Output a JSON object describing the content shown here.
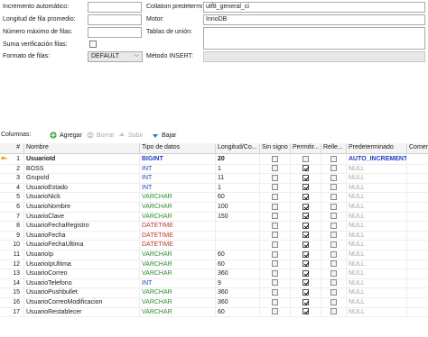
{
  "options": {
    "auto_increment_label": "Incremento automático:",
    "avg_row_length_label": "Longitud de fila promedio:",
    "max_rows_label": "Número máximo de filas:",
    "checksum_label": "Suma verificación filas:",
    "row_format_label": "Formato de filas:",
    "row_format_value": "DEFAULT",
    "collation_label": "Collation predetermi",
    "collation_value": "utf8_general_ci",
    "engine_label": "Motor:",
    "engine_value": "InnoDB",
    "union_tables_label": "Tablas de unión:",
    "insert_method_label": "Método INSERT:"
  },
  "toolbar": {
    "columns_label": "Columnas:",
    "add_label": "Agregar",
    "remove_label": "Borrar",
    "up_label": "Subir",
    "down_label": "Bajar"
  },
  "grid": {
    "headers": [
      "#",
      "Nombre",
      "Tipo de datos",
      "Longitud/Co...",
      "Sin signo",
      "Permitir...",
      "Relle...",
      "Predeterminado",
      "Comen"
    ],
    "rows": [
      {
        "num": "1",
        "name": "UsuarioId",
        "type": "BIGINT",
        "length": "20",
        "unsigned": false,
        "nullable": false,
        "zerofill": false,
        "default": "AUTO_INCREMENT",
        "type_color": "#1f3fbf",
        "default_color": "#1f3fbf",
        "selected": true,
        "key": true
      },
      {
        "num": "2",
        "name": "BOSS",
        "type": "INT",
        "length": "1",
        "unsigned": false,
        "nullable": true,
        "zerofill": false,
        "default": "NULL",
        "type_color": "#1f3fbf",
        "default_color": "#a0a0a0",
        "selected": false,
        "key": false
      },
      {
        "num": "3",
        "name": "GrupoId",
        "type": "INT",
        "length": "11",
        "unsigned": false,
        "nullable": true,
        "zerofill": false,
        "default": "NULL",
        "type_color": "#1f3fbf",
        "default_color": "#a0a0a0",
        "selected": false,
        "key": false
      },
      {
        "num": "4",
        "name": "UsuarioEstado",
        "type": "INT",
        "length": "1",
        "unsigned": false,
        "nullable": true,
        "zerofill": false,
        "default": "NULL",
        "type_color": "#1f3fbf",
        "default_color": "#a0a0a0",
        "selected": false,
        "key": false
      },
      {
        "num": "5",
        "name": "UsuarioNick",
        "type": "VARCHAR",
        "length": "60",
        "unsigned": false,
        "nullable": true,
        "zerofill": false,
        "default": "NULL",
        "type_color": "#2e8b2e",
        "default_color": "#a0a0a0",
        "selected": false,
        "key": false
      },
      {
        "num": "6",
        "name": "UsuarioNombre",
        "type": "VARCHAR",
        "length": "100",
        "unsigned": false,
        "nullable": true,
        "zerofill": false,
        "default": "NULL",
        "type_color": "#2e8b2e",
        "default_color": "#a0a0a0",
        "selected": false,
        "key": false
      },
      {
        "num": "7",
        "name": "UsuarioClave",
        "type": "VARCHAR",
        "length": "150",
        "unsigned": false,
        "nullable": true,
        "zerofill": false,
        "default": "NULL",
        "type_color": "#2e8b2e",
        "default_color": "#a0a0a0",
        "selected": false,
        "key": false
      },
      {
        "num": "8",
        "name": "UsuarioFechaRegistro",
        "type": "DATETIME",
        "length": "",
        "unsigned": false,
        "nullable": true,
        "zerofill": false,
        "default": "NULL",
        "type_color": "#c0392b",
        "default_color": "#a0a0a0",
        "selected": false,
        "key": false
      },
      {
        "num": "9",
        "name": "UsuarioFecha",
        "type": "DATETIME",
        "length": "",
        "unsigned": false,
        "nullable": true,
        "zerofill": false,
        "default": "NULL",
        "type_color": "#c0392b",
        "default_color": "#a0a0a0",
        "selected": false,
        "key": false
      },
      {
        "num": "10",
        "name": "UsuarioFechaUltima",
        "type": "DATETIME",
        "length": "",
        "unsigned": false,
        "nullable": true,
        "zerofill": false,
        "default": "NULL",
        "type_color": "#c0392b",
        "default_color": "#a0a0a0",
        "selected": false,
        "key": false
      },
      {
        "num": "11",
        "name": "UsuarioIp",
        "type": "VARCHAR",
        "length": "60",
        "unsigned": false,
        "nullable": true,
        "zerofill": false,
        "default": "NULL",
        "type_color": "#2e8b2e",
        "default_color": "#a0a0a0",
        "selected": false,
        "key": false
      },
      {
        "num": "12",
        "name": "UsuarioIpUltima",
        "type": "VARCHAR",
        "length": "60",
        "unsigned": false,
        "nullable": true,
        "zerofill": false,
        "default": "NULL",
        "type_color": "#2e8b2e",
        "default_color": "#a0a0a0",
        "selected": false,
        "key": false
      },
      {
        "num": "13",
        "name": "UsuarioCorreo",
        "type": "VARCHAR",
        "length": "360",
        "unsigned": false,
        "nullable": true,
        "zerofill": false,
        "default": "NULL",
        "type_color": "#2e8b2e",
        "default_color": "#a0a0a0",
        "selected": false,
        "key": false
      },
      {
        "num": "14",
        "name": "UsuarioTelefono",
        "type": "INT",
        "length": "9",
        "unsigned": false,
        "nullable": true,
        "zerofill": false,
        "default": "NULL",
        "type_color": "#1f3fbf",
        "default_color": "#a0a0a0",
        "selected": false,
        "key": false
      },
      {
        "num": "15",
        "name": "UsuarioPushbullet",
        "type": "VARCHAR",
        "length": "360",
        "unsigned": false,
        "nullable": true,
        "zerofill": false,
        "default": "NULL",
        "type_color": "#2e8b2e",
        "default_color": "#a0a0a0",
        "selected": false,
        "key": false
      },
      {
        "num": "16",
        "name": "UsuarioCorreoModificacion",
        "type": "VARCHAR",
        "length": "360",
        "unsigned": false,
        "nullable": true,
        "zerofill": false,
        "default": "NULL",
        "type_color": "#2e8b2e",
        "default_color": "#a0a0a0",
        "selected": false,
        "key": false
      },
      {
        "num": "17",
        "name": "UsuarioRestablecer",
        "type": "VARCHAR",
        "length": "60",
        "unsigned": false,
        "nullable": true,
        "zerofill": false,
        "default": "NULL",
        "type_color": "#2e8b2e",
        "default_color": "#a0a0a0",
        "selected": false,
        "key": false
      }
    ]
  },
  "colors": {
    "int_type": "#1f3fbf",
    "varchar_type": "#2e8b2e",
    "datetime_type": "#c0392b",
    "null_default": "#a0a0a0",
    "key_icon": "#e6a800"
  }
}
